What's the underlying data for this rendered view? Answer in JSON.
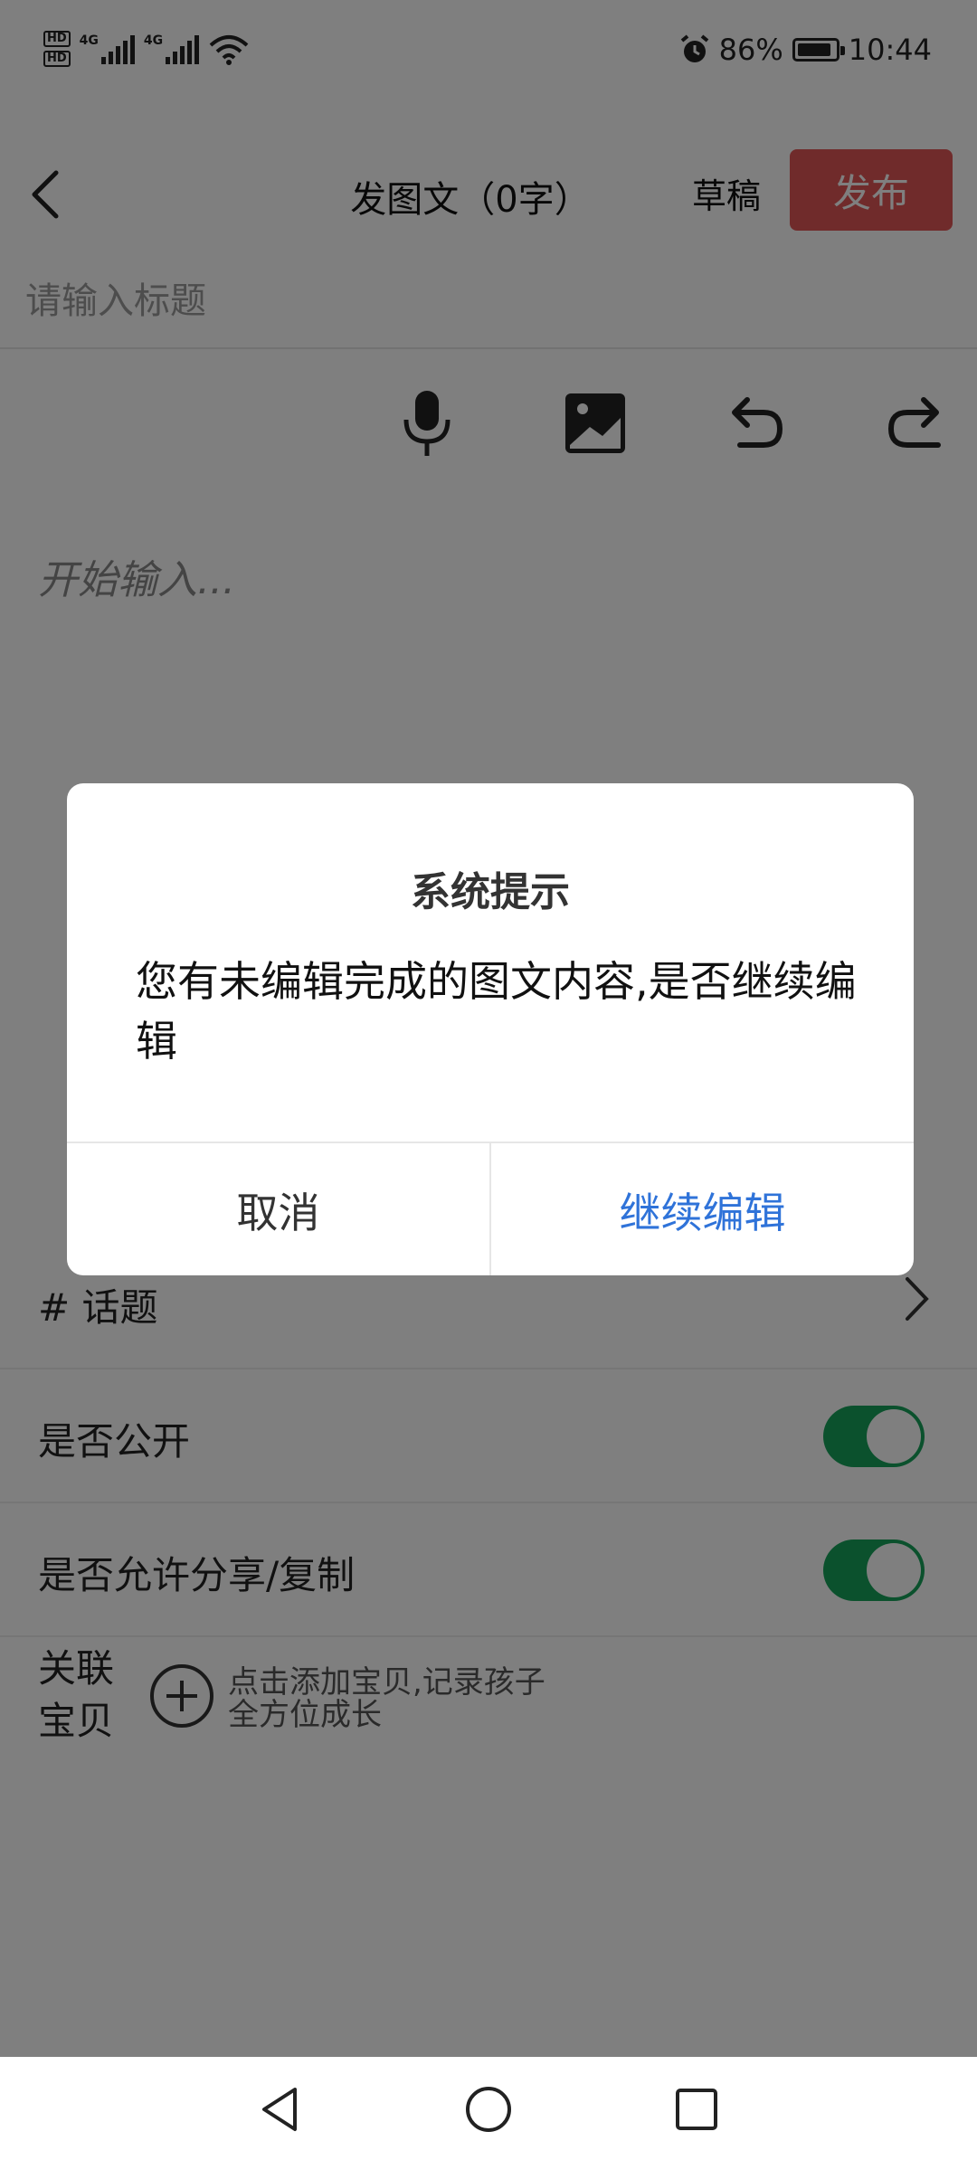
{
  "status_bar": {
    "hd1": "HD",
    "hd2": "HD",
    "net1": "4G",
    "net2": "4G",
    "battery_percent": "86%",
    "time": "10:44"
  },
  "header": {
    "title": "发图文（0字）",
    "draft_label": "草稿",
    "publish_label": "发布"
  },
  "editor": {
    "title_placeholder": "请输入标题",
    "content_placeholder": "开始输入..."
  },
  "toolbar": {
    "icons": [
      "microphone-icon",
      "image-icon",
      "undo-icon",
      "redo-icon"
    ]
  },
  "options": {
    "topic_label": "# 话题",
    "public_label": "是否公开",
    "public_on": true,
    "share_label": "是否允许分享/复制",
    "share_on": true,
    "assoc_label_line1": "关联",
    "assoc_label_line2": "宝贝",
    "assoc_hint": "点击添加宝贝,记录孩子全方位成长"
  },
  "dialog": {
    "title": "系统提示",
    "message": "您有未编辑完成的图文内容,是否继续编辑",
    "cancel_label": "取消",
    "confirm_label": "继续编辑"
  },
  "colors": {
    "publish": "#e05656",
    "toggle_on": "#17a35a",
    "confirm": "#2f73d9"
  }
}
